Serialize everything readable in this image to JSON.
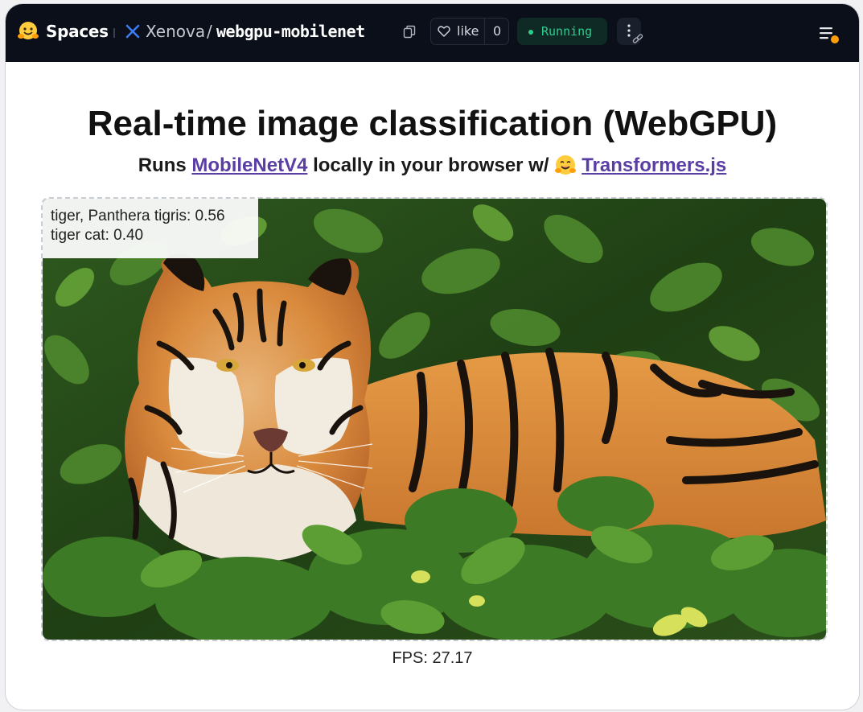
{
  "header": {
    "spaces_label": "Spaces",
    "owner": "Xenova",
    "repo": "webgpu-mobilenet",
    "like_label": "like",
    "like_count": "0",
    "status": "Running",
    "icons": [
      "hugging-face-logo",
      "x-icon",
      "copy-icon",
      "heart-icon",
      "kebab-icon",
      "link-icon",
      "menu-icon"
    ],
    "status_color": "#2ecc8e"
  },
  "main": {
    "title": "Real-time image classification (WebGPU)",
    "subtitle_prefix": "Runs",
    "model_link": "MobileNetV4",
    "subtitle_middle": "locally in your browser w/",
    "lib_link": "Transformers.js",
    "link_color": "#5a3ea3"
  },
  "predictions": [
    {
      "label": "tiger, Panthera tigris",
      "score": "0.56"
    },
    {
      "label": "tiger cat",
      "score": "0.40"
    }
  ],
  "predictions_text": [
    "tiger, Panthera tigris: 0.56",
    "tiger cat: 0.40"
  ],
  "fps_label": "FPS: 27.17"
}
